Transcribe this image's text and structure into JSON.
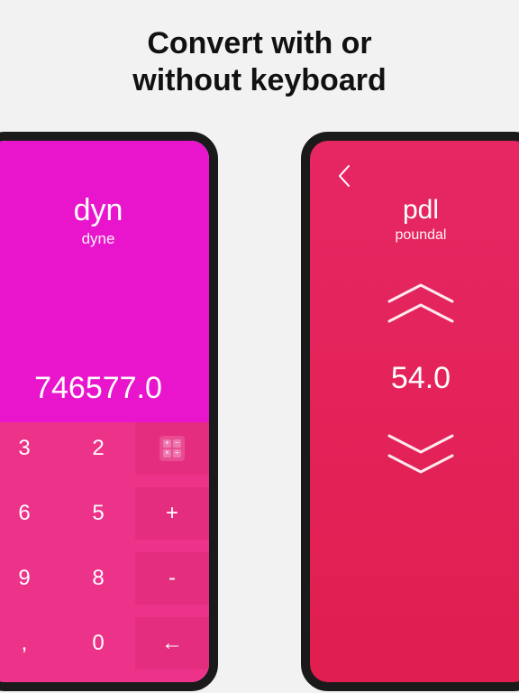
{
  "headline": {
    "line1": "Convert with or",
    "line2": "without keyboard"
  },
  "left": {
    "unit_abbr": "dyn",
    "unit_name": "dyne",
    "value": "746577.0",
    "keys": {
      "r0c0": "3",
      "r0c1": "2",
      "r1c0": "6",
      "r1c1": "5",
      "r1c2": "+",
      "r2c0": "9",
      "r2c1": "8",
      "r2c2": "-",
      "r3c0": ",",
      "r3c1": "0",
      "r3c2": "←"
    }
  },
  "right": {
    "unit_abbr": "pdl",
    "unit_name": "poundal",
    "value": "54.0"
  }
}
